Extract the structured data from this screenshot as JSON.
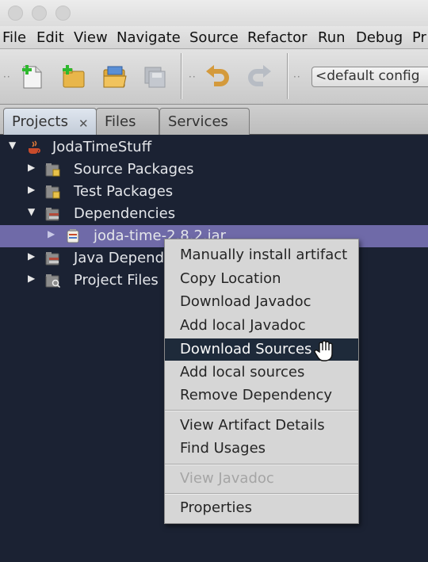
{
  "menubar": {
    "items": [
      {
        "label": "File"
      },
      {
        "label": "Edit"
      },
      {
        "label": "View"
      },
      {
        "label": "Navigate"
      },
      {
        "label": "Source"
      },
      {
        "label": "Refactor"
      },
      {
        "label": "Run"
      },
      {
        "label": "Debug"
      },
      {
        "label": "Pr"
      }
    ]
  },
  "toolbar": {
    "icons": [
      "new-file-icon",
      "new-project-icon",
      "open-project-icon",
      "save-all-icon",
      "undo-icon",
      "redo-icon"
    ],
    "config_label": "<default config"
  },
  "tabs": [
    {
      "label": "Projects",
      "active": true
    },
    {
      "label": "Files",
      "active": false
    },
    {
      "label": "Services",
      "active": false
    }
  ],
  "tree": {
    "project": "JodaTimeStuff",
    "nodes": [
      {
        "label": "Source Packages"
      },
      {
        "label": "Test Packages"
      },
      {
        "label": "Dependencies"
      },
      {
        "label": "joda-time-2.8.2.jar"
      },
      {
        "label": "Java Depend"
      },
      {
        "label": "Project Files"
      }
    ]
  },
  "context_menu": {
    "items": [
      {
        "label": "Manually install artifact"
      },
      {
        "label": "Copy Location"
      },
      {
        "label": "Download Javadoc"
      },
      {
        "label": "Add local Javadoc"
      },
      {
        "label": "Download Sources"
      },
      {
        "label": "Add local sources"
      },
      {
        "label": "Remove Dependency"
      },
      {
        "label": "View Artifact Details"
      },
      {
        "label": "Find Usages"
      },
      {
        "label": "View Javadoc"
      },
      {
        "label": "Properties"
      }
    ]
  },
  "colors": {
    "tree_background": "#1b2233",
    "selection": "#6f6aa8",
    "menu_highlight": "#1e2a3a"
  }
}
